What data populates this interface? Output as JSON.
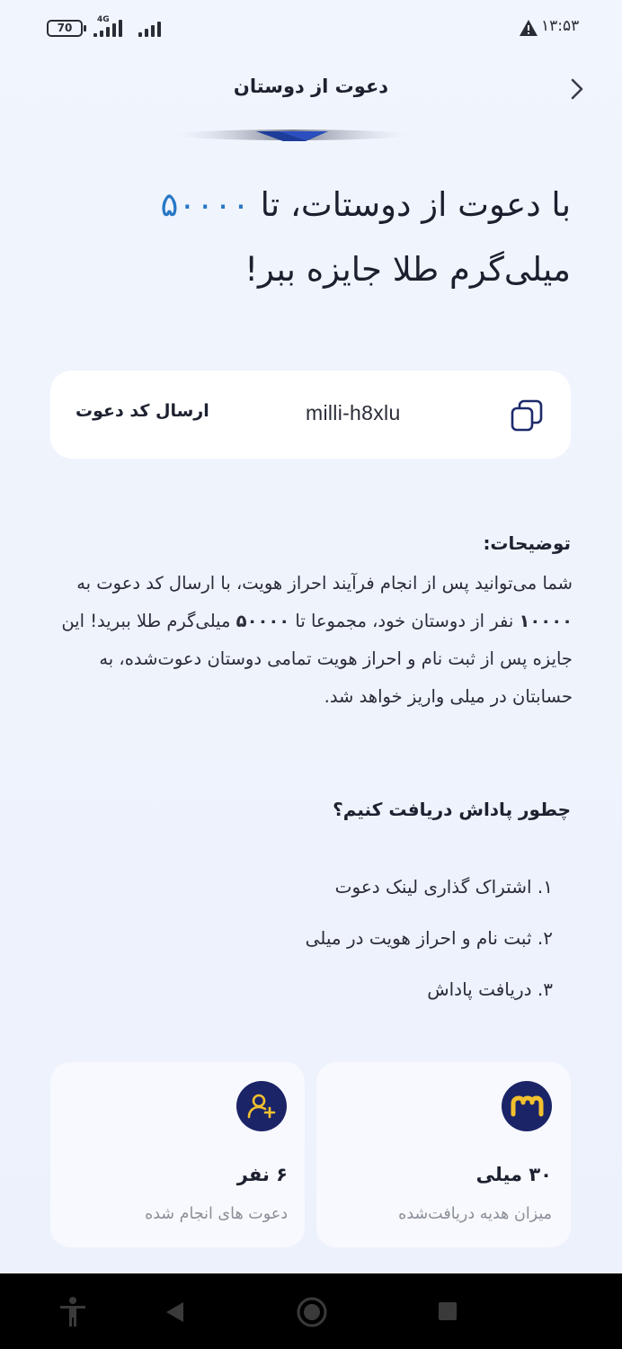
{
  "status_bar": {
    "battery": "70",
    "network": "4G",
    "time": "۱۳:۵۳"
  },
  "header": {
    "title": "دعوت از دوستان"
  },
  "headline": {
    "before": "با دعوت از دوستات، تا ",
    "amount": "۵۰۰۰۰",
    "after": " میلی‌گرم طلا جایزه ببر!"
  },
  "invite": {
    "send_label": "ارسال کد دعوت",
    "code": "milli-h8xlu"
  },
  "description": {
    "title": "توضیحات:",
    "part1": "شما می‌توانید پس از انجام فرآیند احراز هویت، با ارسال کد دعوت به ",
    "count": "۱۰۰۰۰",
    "part2": " نفر از دوستان خود، مجموعا تا ",
    "amount": "۵۰۰۰۰",
    "part3": " میلی‌گرم طلا ببرید! این جایزه پس از ثبت نام و احراز هویت تمامی دوستان دعوت‌شده، به حسابتان در میلی واریز خواهد شد."
  },
  "how": {
    "title": "چطور پاداش دریافت کنیم؟",
    "steps": [
      "۱. اشتراک گذاری لینک دعوت",
      "۲. ثبت نام و احراز هویت در میلی",
      "۳. دریافت پاداش"
    ]
  },
  "stats": {
    "reward": {
      "value": "۳۰ میلی",
      "label": "میزان هدیه دریافت‌شده"
    },
    "invites": {
      "value": "۶ نفر",
      "label": "دعوت های انجام شده"
    }
  },
  "colors": {
    "accent": "#2878c6",
    "icon_bg": "#1c2468",
    "icon_fg": "#f2c12e"
  }
}
